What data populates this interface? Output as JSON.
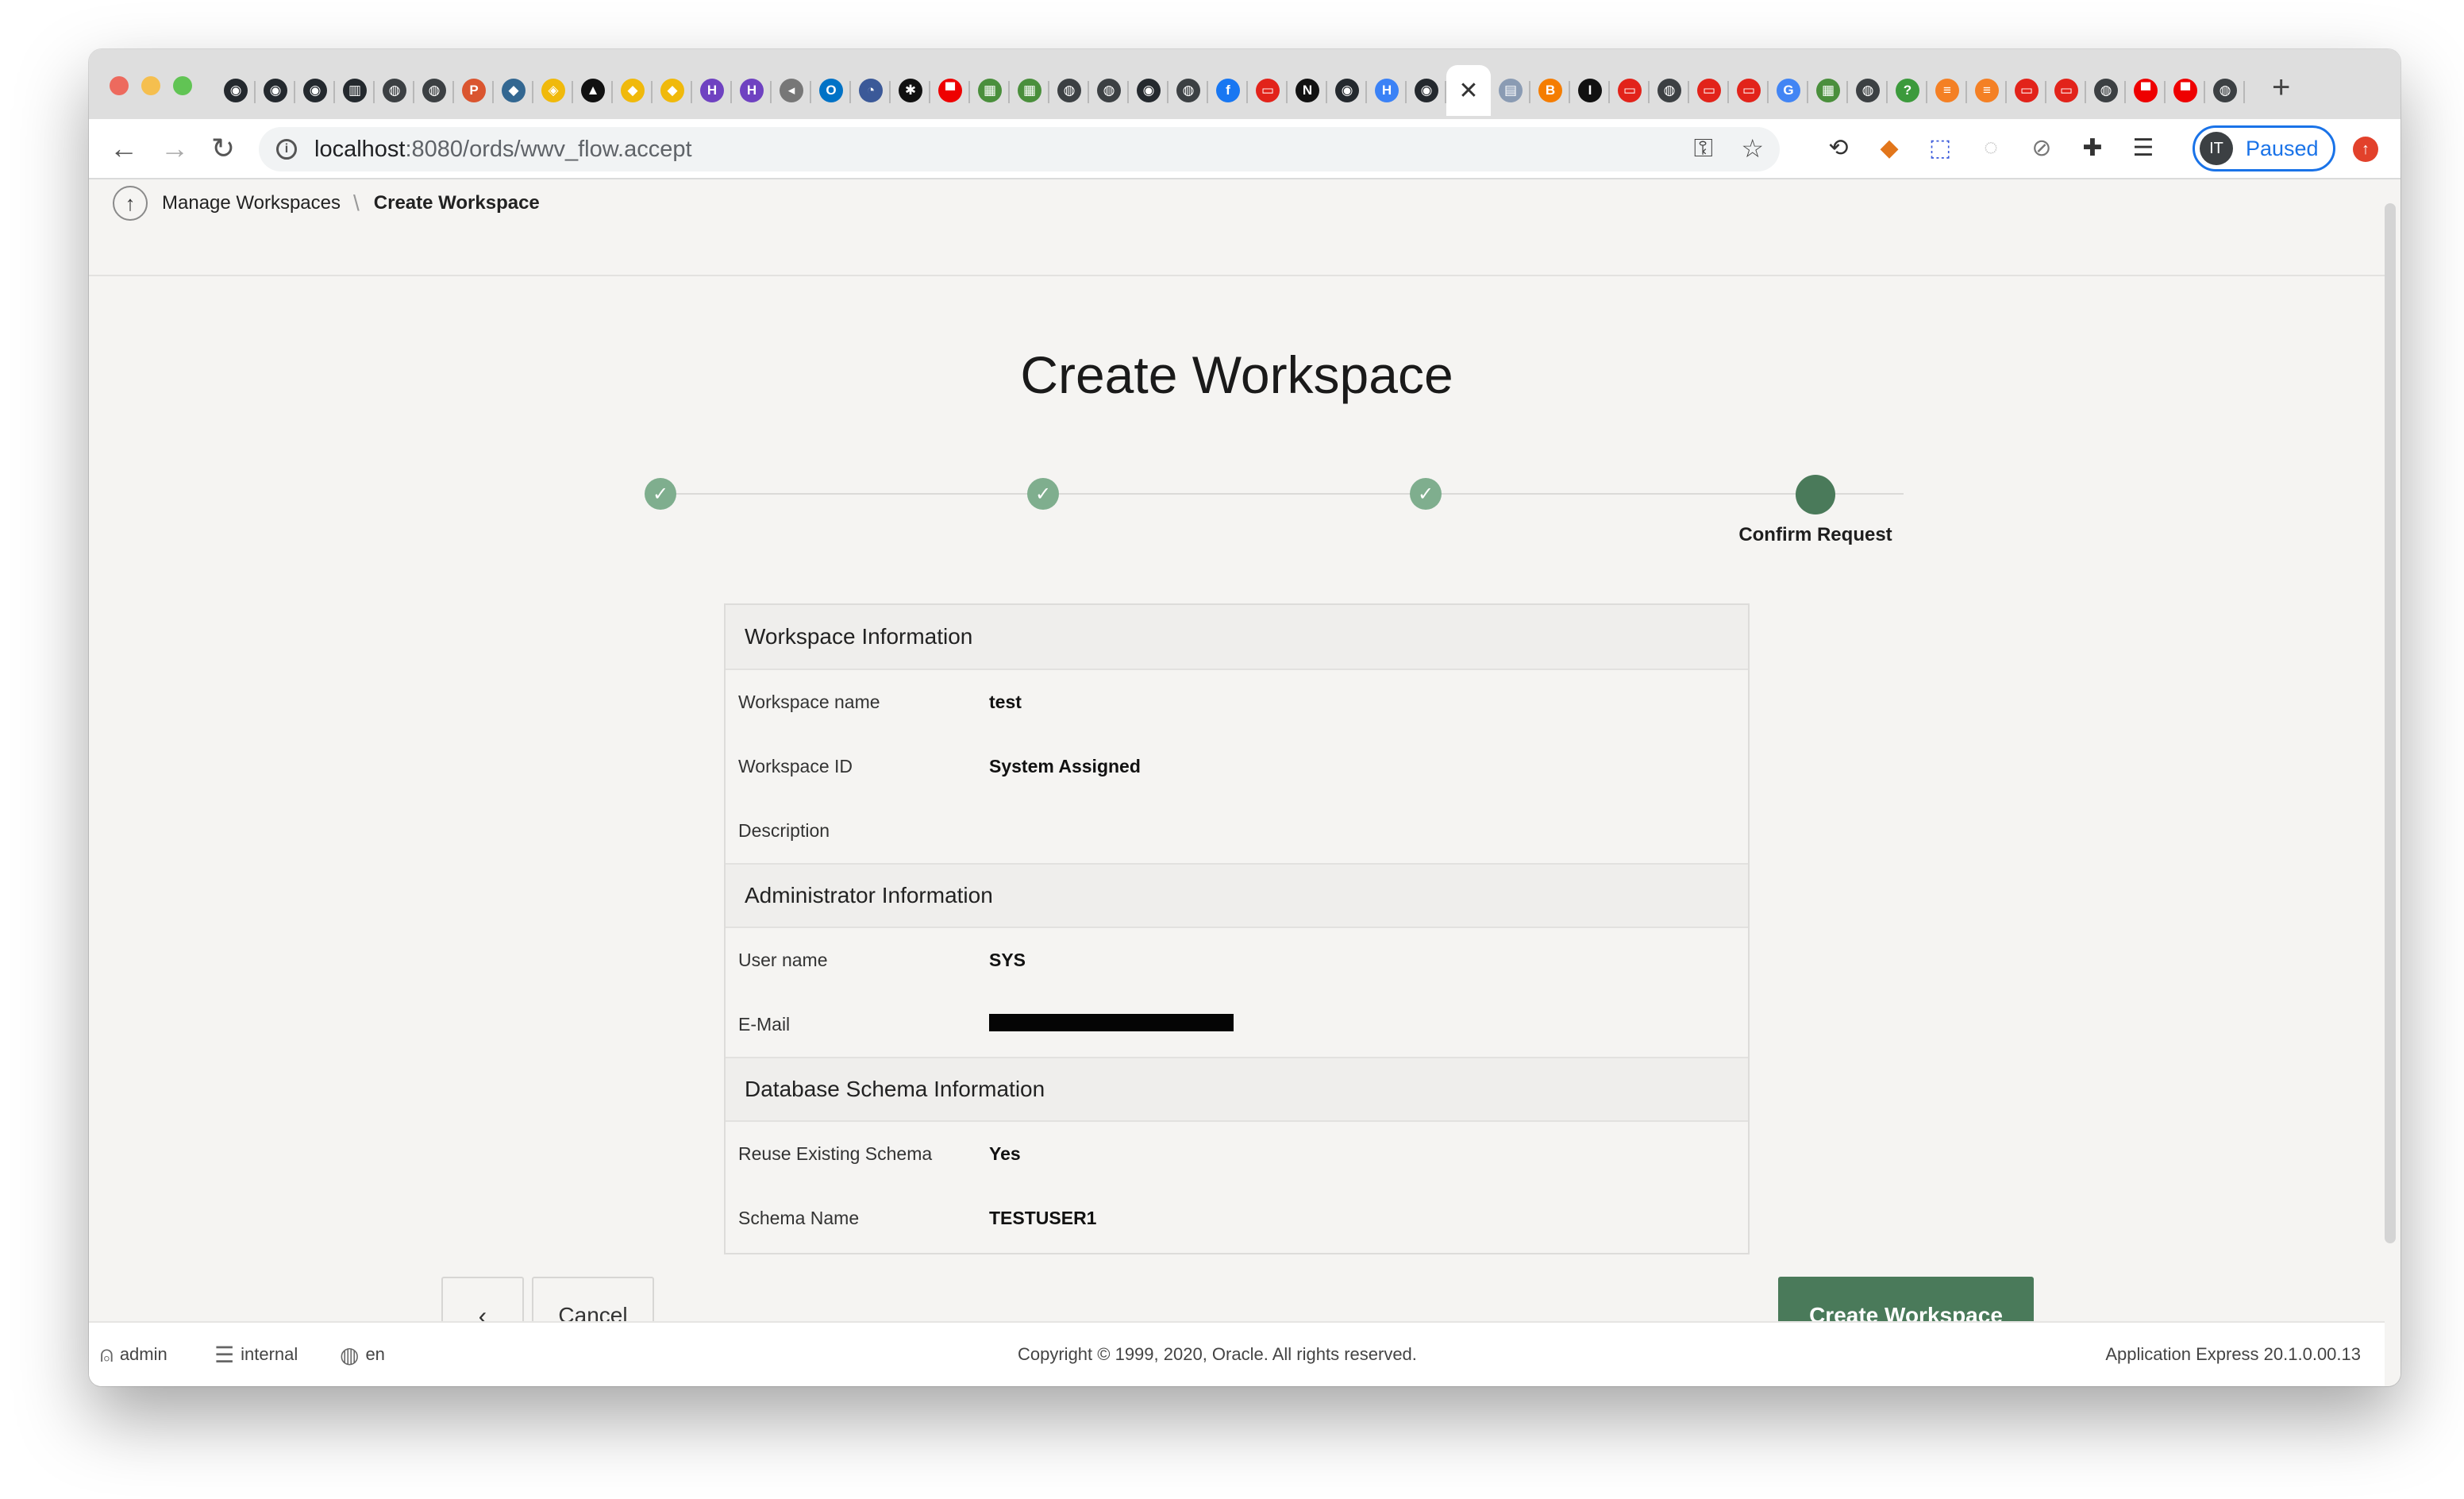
{
  "browser": {
    "tabs": [
      {
        "icon": "github-icon",
        "color": "#24292e",
        "glyph": "◉"
      },
      {
        "icon": "github-icon",
        "color": "#24292e",
        "glyph": "◉"
      },
      {
        "icon": "github-icon",
        "color": "#24292e",
        "glyph": "◉"
      },
      {
        "icon": "docs-icon",
        "color": "#24292e",
        "glyph": "▥"
      },
      {
        "icon": "globe-icon",
        "color": "#3c4043",
        "glyph": "◍"
      },
      {
        "icon": "globe-icon",
        "color": "#3c4043",
        "glyph": "◍"
      },
      {
        "icon": "producthunt-icon",
        "color": "#da552f",
        "glyph": "P"
      },
      {
        "icon": "postgres-icon",
        "color": "#336791",
        "glyph": "◆"
      },
      {
        "icon": "box-icon",
        "color": "#f0b90b",
        "glyph": "◈"
      },
      {
        "icon": "graduation-cap-icon",
        "color": "#111111",
        "glyph": "▲"
      },
      {
        "icon": "binance-icon",
        "color": "#f0b90b",
        "glyph": "◆"
      },
      {
        "icon": "binance-icon",
        "color": "#f0b90b",
        "glyph": "◆"
      },
      {
        "icon": "h-icon",
        "color": "#6f42c1",
        "glyph": "H"
      },
      {
        "icon": "h-icon",
        "color": "#6f42c1",
        "glyph": "H"
      },
      {
        "icon": "speaker-icon",
        "color": "#777777",
        "glyph": "◂"
      },
      {
        "icon": "outlook-icon",
        "color": "#0072c6",
        "glyph": "O"
      },
      {
        "icon": "chart-icon",
        "color": "#3b5998",
        "glyph": "◔"
      },
      {
        "icon": "star-burst-icon",
        "color": "#111111",
        "glyph": "✱"
      },
      {
        "icon": "red-hat-icon",
        "color": "#ee0000",
        "glyph": "▀"
      },
      {
        "icon": "map-icon",
        "color": "#4a8f3c",
        "glyph": "▦"
      },
      {
        "icon": "map-icon",
        "color": "#4a8f3c",
        "glyph": "▦"
      },
      {
        "icon": "globe-icon",
        "color": "#3c4043",
        "glyph": "◍"
      },
      {
        "icon": "globe-icon",
        "color": "#3c4043",
        "glyph": "◍"
      },
      {
        "icon": "github-icon",
        "color": "#24292e",
        "glyph": "◉"
      },
      {
        "icon": "globe-icon",
        "color": "#3c4043",
        "glyph": "◍"
      },
      {
        "icon": "facebook-icon",
        "color": "#1877f2",
        "glyph": "f"
      },
      {
        "icon": "oracle-icon",
        "color": "#e2231a",
        "glyph": "▭"
      },
      {
        "icon": "n-icon",
        "color": "#111111",
        "glyph": "N"
      },
      {
        "icon": "github-icon",
        "color": "#24292e",
        "glyph": "◉"
      },
      {
        "icon": "h-icon",
        "color": "#3b82f6",
        "glyph": "H"
      },
      {
        "icon": "github-icon",
        "color": "#24292e",
        "glyph": "◉"
      }
    ],
    "active_tab_close": "✕",
    "tabs_right": [
      {
        "icon": "page-icon",
        "color": "#8a9bb3",
        "glyph": "▤"
      },
      {
        "icon": "blogger-icon",
        "color": "#f57d00",
        "glyph": "B"
      },
      {
        "icon": "instapaper-icon",
        "color": "#111111",
        "glyph": "I"
      },
      {
        "icon": "oracle-icon",
        "color": "#e2231a",
        "glyph": "▭"
      },
      {
        "icon": "globe-icon",
        "color": "#3c4043",
        "glyph": "◍"
      },
      {
        "icon": "oracle-icon",
        "color": "#e2231a",
        "glyph": "▭"
      },
      {
        "icon": "oracle-icon",
        "color": "#e2231a",
        "glyph": "▭"
      },
      {
        "icon": "google-icon",
        "color": "#4285f4",
        "glyph": "G"
      },
      {
        "icon": "map-icon",
        "color": "#4a8f3c",
        "glyph": "▦"
      },
      {
        "icon": "globe-icon",
        "color": "#3c4043",
        "glyph": "◍"
      },
      {
        "icon": "question-icon",
        "color": "#3c9a3c",
        "glyph": "?"
      },
      {
        "icon": "stackoverflow-icon",
        "color": "#f48024",
        "glyph": "≡"
      },
      {
        "icon": "stackoverflow-icon",
        "color": "#f48024",
        "glyph": "≡"
      },
      {
        "icon": "oracle-icon",
        "color": "#e2231a",
        "glyph": "▭"
      },
      {
        "icon": "oracle-icon",
        "color": "#e2231a",
        "glyph": "▭"
      },
      {
        "icon": "globe-icon",
        "color": "#3c4043",
        "glyph": "◍"
      },
      {
        "icon": "red-hat-icon",
        "color": "#ee0000",
        "glyph": "▀"
      },
      {
        "icon": "red-hat-icon",
        "color": "#ee0000",
        "glyph": "▀"
      },
      {
        "icon": "globe-icon",
        "color": "#3c4043",
        "glyph": "◍"
      }
    ],
    "new_tab": "+",
    "url_host": "localhost",
    "url_rest": ":8080/ords/wwv_flow.accept",
    "profile_initials": "IT",
    "profile_status": "Paused"
  },
  "breadcrumb": {
    "parent": "Manage Workspaces",
    "current": "Create Workspace"
  },
  "page": {
    "title": "Create Workspace",
    "current_step_label": "Confirm Request",
    "accent_color": "#4a7a5a"
  },
  "sections": {
    "workspace": {
      "heading": "Workspace Information",
      "rows": [
        {
          "label": "Workspace name",
          "value": "test"
        },
        {
          "label": "Workspace ID",
          "value": "System Assigned"
        },
        {
          "label": "Description",
          "value": ""
        }
      ]
    },
    "admin": {
      "heading": "Administrator Information",
      "rows": [
        {
          "label": "User name",
          "value": "SYS"
        },
        {
          "label": "E-Mail",
          "value": ""
        }
      ]
    },
    "schema": {
      "heading": "Database Schema Information",
      "rows": [
        {
          "label": "Reuse Existing Schema",
          "value": "Yes"
        },
        {
          "label": "Schema Name",
          "value": "TESTUSER1"
        }
      ]
    }
  },
  "buttons": {
    "back": "‹",
    "cancel": "Cancel",
    "create": "Create Workspace"
  },
  "footer": {
    "user": "admin",
    "workspace": "internal",
    "language": "en",
    "copyright": "Copyright © 1999, 2020, Oracle. All rights reserved.",
    "version": "Application Express 20.1.0.00.13"
  }
}
